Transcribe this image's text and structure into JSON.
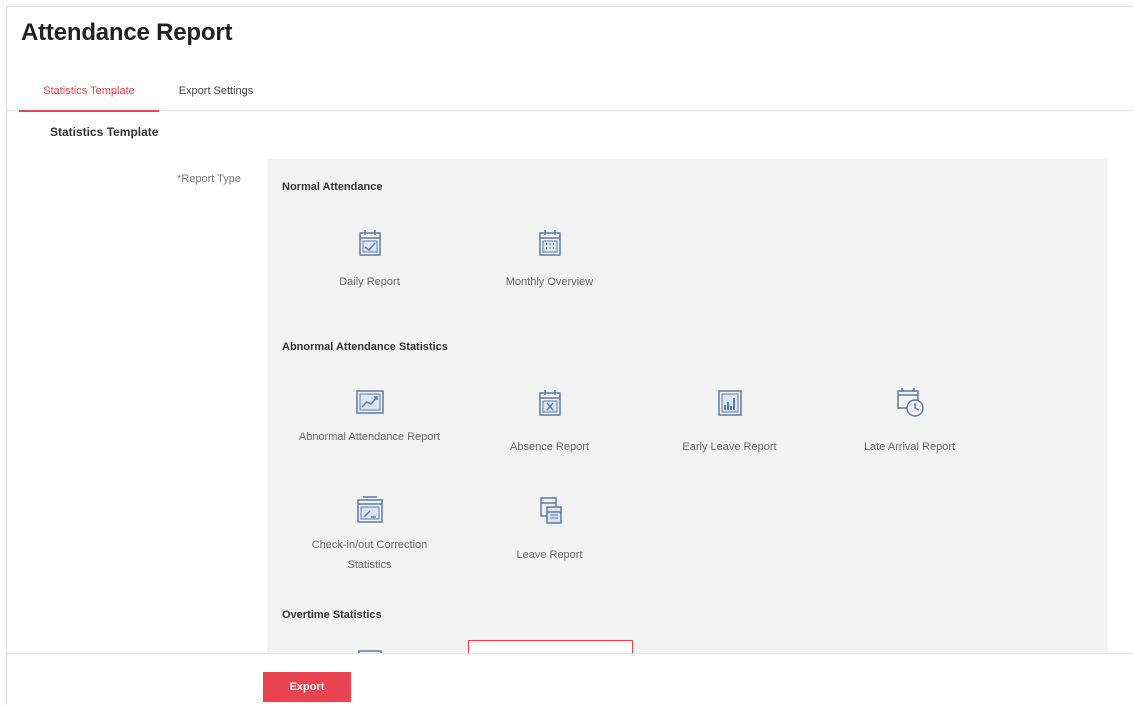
{
  "page": {
    "title": "Attendance Report"
  },
  "tabs": [
    {
      "label": "Statistics Template",
      "active": true
    },
    {
      "label": "Export Settings",
      "active": false
    }
  ],
  "section": {
    "title": "Statistics Template"
  },
  "form": {
    "report_type_label": "*Report Type"
  },
  "groups": {
    "normal": {
      "title": "Normal Attendance",
      "items": [
        {
          "label": "Daily Report",
          "icon": "calendar-check-icon"
        },
        {
          "label": "Monthly Overview",
          "icon": "calendar-grid-icon"
        }
      ]
    },
    "abnormal": {
      "title": "Abnormal Attendance Statistics",
      "items": [
        {
          "label": "Abnormal Attendance Report",
          "icon": "trend-chart-icon"
        },
        {
          "label": "Absence Report",
          "icon": "calendar-x-icon"
        },
        {
          "label": "Early Leave Report",
          "icon": "bar-chart-icon"
        },
        {
          "label": "Late Arrival Report",
          "icon": "calendar-clock-icon"
        },
        {
          "label": "Check-in/out Correction Statistics",
          "icon": "window-edit-icon"
        },
        {
          "label": "Leave Report",
          "icon": "leave-calendar-icon"
        }
      ]
    },
    "overtime": {
      "title": "Overtime Statistics",
      "items": [
        {
          "label": "",
          "icon": "overtime-report-icon"
        },
        {
          "label": "",
          "icon": "overtime-clock-icon"
        }
      ]
    }
  },
  "footer": {
    "export_label": "Export"
  },
  "colors": {
    "accent": "#e8434e",
    "icon": "#5a7aa8",
    "panel": "#f2f2f2"
  }
}
